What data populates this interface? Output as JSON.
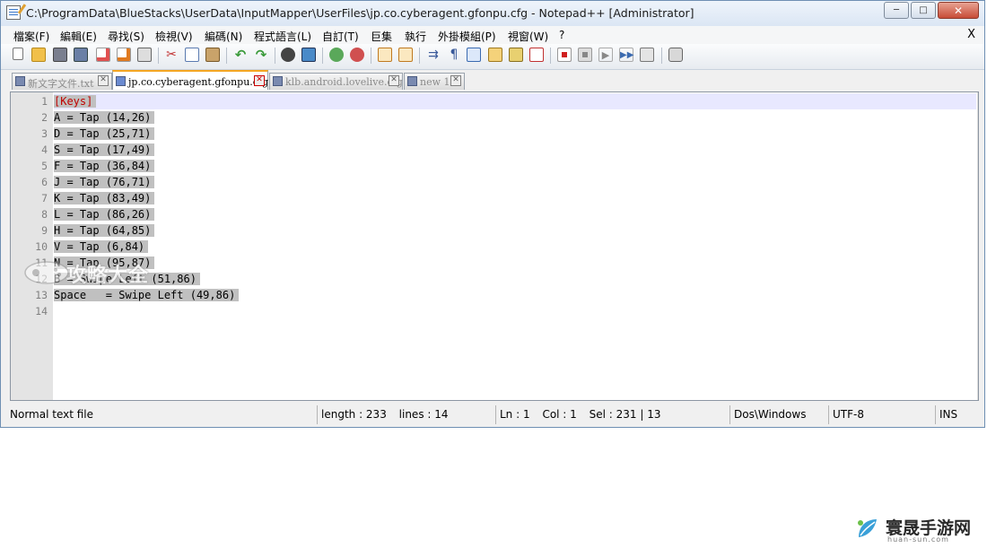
{
  "window": {
    "title": "C:\\ProgramData\\BlueStacks\\UserData\\InputMapper\\UserFiles\\jp.co.cyberagent.gfonpu.cfg - Notepad++ [Administrator]",
    "minimize": "─",
    "maximize": "□",
    "close": "✕"
  },
  "menu": {
    "items": [
      "檔案(F)",
      "編輯(E)",
      "尋找(S)",
      "檢視(V)",
      "編碼(N)",
      "程式語言(L)",
      "自訂(T)",
      "巨集",
      "執行",
      "外掛模組(P)",
      "視窗(W)",
      "?"
    ],
    "close": "X"
  },
  "toolbar": {
    "icons": [
      "new-file-icon",
      "open-file-icon",
      "save-icon",
      "save-all-icon",
      "close-icon",
      "close-all-icon",
      "print-icon",
      "cut-icon",
      "copy-icon",
      "paste-icon",
      "undo-icon",
      "redo-icon",
      "find-icon",
      "replace-icon",
      "zoom-in-icon",
      "zoom-out-icon",
      "sync-v-icon",
      "sync-h-icon",
      "word-wrap-icon",
      "show-all-chars-icon",
      "indent-guide-icon",
      "udl-icon",
      "doc-map-icon",
      "function-list-icon",
      "record-macro-icon",
      "stop-record-icon",
      "play-macro-icon",
      "run-macro-multiple-icon",
      "save-macro-icon",
      "spellcheck-icon"
    ]
  },
  "tabs": [
    {
      "label": "新文字文件.txt",
      "active": false
    },
    {
      "label": "jp.co.cyberagent.gfonpu.cfg",
      "active": true
    },
    {
      "label": "klb.android.lovelive.cfg",
      "active": false
    },
    {
      "label": "new 1",
      "active": false
    }
  ],
  "editor": {
    "line_numbers": [
      "1",
      "2",
      "3",
      "4",
      "5",
      "6",
      "7",
      "8",
      "9",
      "10",
      "11",
      "12",
      "13",
      "14"
    ],
    "lines": [
      "[Keys]",
      "A = Tap (14,26)",
      "D = Tap (25,71)",
      "S = Tap (17,49)",
      "F = Tap (36,84)",
      "J = Tap (76,71)",
      "K = Tap (83,49)",
      "L = Tap (86,26)",
      "H = Tap (64,85)",
      "V = Tap (6,84)",
      "N = Tap (95,87)",
      "B = Swipe Left (51,86)",
      "Space   = Swipe Left (49,86)",
      ""
    ],
    "watermark": "攻略大全"
  },
  "status": {
    "file_type": "Normal text file",
    "length": "length : 233",
    "lines": "lines : 14",
    "ln": "Ln : 1",
    "col": "Col : 1",
    "sel": "Sel : 231 | 13",
    "eol": "Dos\\Windows",
    "encoding": "UTF-8",
    "mode": "INS"
  },
  "brand": {
    "name": "寰晟手游网",
    "url": "huan-sun.com"
  }
}
